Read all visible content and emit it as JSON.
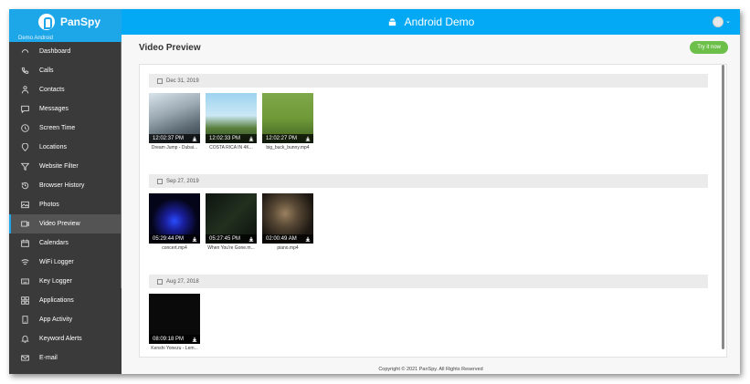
{
  "app": {
    "brand": "PanSpy",
    "account_label": "Demo Android",
    "header_title": "Android Demo",
    "try_button": "Try it now"
  },
  "sidebar": {
    "items": [
      {
        "label": "Dashboard",
        "icon": "dashboard-icon"
      },
      {
        "label": "Calls",
        "icon": "phone-icon"
      },
      {
        "label": "Contacts",
        "icon": "user-icon"
      },
      {
        "label": "Messages",
        "icon": "message-icon"
      },
      {
        "label": "Screen Time",
        "icon": "clock-icon"
      },
      {
        "label": "Locations",
        "icon": "location-pin-icon"
      },
      {
        "label": "Website Filter",
        "icon": "filter-icon"
      },
      {
        "label": "Browser History",
        "icon": "history-icon"
      },
      {
        "label": "Photos",
        "icon": "image-icon"
      },
      {
        "label": "Video Preview",
        "icon": "video-icon",
        "active": true
      },
      {
        "label": "Calendars",
        "icon": "calendar-icon"
      },
      {
        "label": "WiFi Logger",
        "icon": "wifi-icon"
      },
      {
        "label": "Key Logger",
        "icon": "keyboard-icon"
      },
      {
        "label": "Applications",
        "icon": "apps-grid-icon"
      },
      {
        "label": "App Activity",
        "icon": "activity-icon"
      },
      {
        "label": "Keyword Alerts",
        "icon": "bell-icon"
      },
      {
        "label": "E-mail",
        "icon": "mail-icon"
      }
    ]
  },
  "main": {
    "page_title": "Video Preview",
    "groups": [
      {
        "date": "Dec 31, 2019",
        "videos": [
          {
            "time": "12:02:37 PM",
            "name": "Dream Jump - Dubai..."
          },
          {
            "time": "12:02:33 PM",
            "name": "COSTA RICA IN 4K..."
          },
          {
            "time": "12:02:27 PM",
            "name": "big_buck_bunny.mp4"
          }
        ]
      },
      {
        "date": "Sep 27, 2019",
        "videos": [
          {
            "time": "05:29:44 PM",
            "name": "concert.mp4"
          },
          {
            "time": "05:27:45 PM",
            "name": "When You're Gone.m..."
          },
          {
            "time": "02:00:49 AM",
            "name": "piano.mp4"
          }
        ]
      },
      {
        "date": "Aug 27, 2018",
        "videos": [
          {
            "time": "08:09:18 PM",
            "name": "Kenshi Yonezu - Lem..."
          }
        ]
      }
    ],
    "footer": "Copyright © 2021 PanSpy. All Rights Reserved"
  },
  "colors": {
    "header": "#03a9f4",
    "brand": "#1ea7e8",
    "sidebar": "#3a3a3a",
    "try_button": "#6cc04a"
  }
}
